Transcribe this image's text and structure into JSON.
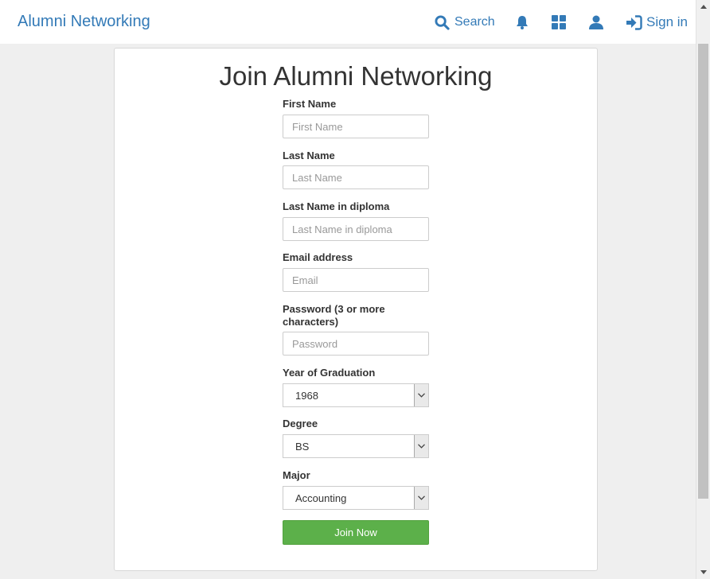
{
  "header": {
    "brand": "Alumni Networking",
    "search_label": "Search",
    "signin_label": "Sign in",
    "accent_color": "#337ab7"
  },
  "form": {
    "title": "Join Alumni Networking",
    "first_name": {
      "label": "First Name",
      "placeholder": "First Name",
      "value": ""
    },
    "last_name": {
      "label": "Last Name",
      "placeholder": "Last Name",
      "value": ""
    },
    "last_name_diploma": {
      "label": "Last Name in diploma",
      "placeholder": "Last Name in diploma",
      "value": ""
    },
    "email": {
      "label": "Email address",
      "placeholder": "Email",
      "value": ""
    },
    "password": {
      "label": "Password (3 or more characters)",
      "placeholder": "Password",
      "value": ""
    },
    "year": {
      "label": "Year of Graduation",
      "selected": "1968"
    },
    "degree": {
      "label": "Degree",
      "selected": "BS"
    },
    "major": {
      "label": "Major",
      "selected": "Accounting"
    },
    "submit_label": "Join Now",
    "submit_color": "#5cb04a"
  },
  "icons": {
    "search": "search-icon",
    "notifications": "bell-icon",
    "apps": "grid-icon",
    "profile": "user-icon",
    "signin": "sign-in-icon"
  }
}
